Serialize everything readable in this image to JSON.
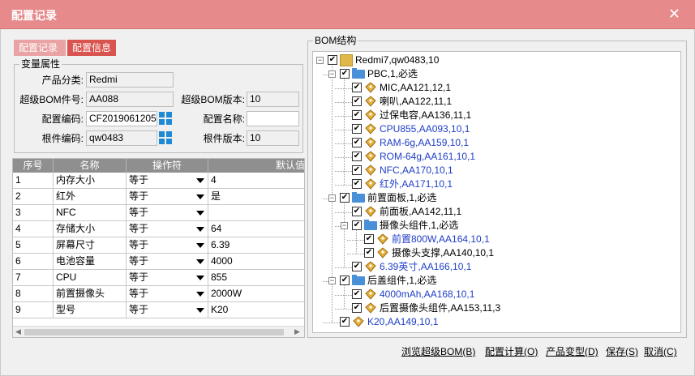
{
  "window": {
    "title": "配置记录"
  },
  "tabs": [
    {
      "label": "配置记录"
    },
    {
      "label": "配置信息"
    }
  ],
  "variables": {
    "legend": "变量属性",
    "product_category_label": "产品分类:",
    "product_category_value": "Redmi",
    "super_bom_no_label": "超级BOM件号:",
    "super_bom_no_value": "AA088",
    "super_bom_ver_label": "超级BOM版本:",
    "super_bom_ver_value": "10",
    "config_code_label": "配置编码:",
    "config_code_value": "CF2019061205",
    "config_name_label": "配置名称:",
    "config_name_value": "",
    "root_code_label": "根件编码:",
    "root_code_value": "qw0483",
    "root_ver_label": "根件版本:",
    "root_ver_value": "10"
  },
  "grid": {
    "headers": [
      "序号",
      "名称",
      "操作符",
      "默认值"
    ],
    "rows": [
      {
        "no": "1",
        "name": "内存大小",
        "op": "等于",
        "val": "4"
      },
      {
        "no": "2",
        "name": "红外",
        "op": "等于",
        "val": "是"
      },
      {
        "no": "3",
        "name": "NFC",
        "op": "等于",
        "val": ""
      },
      {
        "no": "4",
        "name": "存储大小",
        "op": "等于",
        "val": "64"
      },
      {
        "no": "5",
        "name": "屏幕尺寸",
        "op": "等于",
        "val": "6.39"
      },
      {
        "no": "6",
        "name": "电池容量",
        "op": "等于",
        "val": "4000"
      },
      {
        "no": "7",
        "name": "CPU",
        "op": "等于",
        "val": "855"
      },
      {
        "no": "8",
        "name": "前置摄像头",
        "op": "等于",
        "val": "2000W"
      },
      {
        "no": "9",
        "name": "型号",
        "op": "等于",
        "val": "K20"
      }
    ]
  },
  "bom": {
    "legend": "BOM结构",
    "nodes": [
      {
        "label": "Redmi7,qw0483,10",
        "icon": "box-icon",
        "blue": false
      },
      {
        "label": "PBC,1,必选",
        "icon": "folder-icon",
        "blue": false
      },
      {
        "label": "MIC,AA121,12,1",
        "icon": "part-icon",
        "blue": false
      },
      {
        "label": "喇叭,AA122,11,1",
        "icon": "part-icon",
        "blue": false
      },
      {
        "label": "过保电容,AA136,11,1",
        "icon": "part-icon",
        "blue": false
      },
      {
        "label": "CPU855,AA093,10,1",
        "icon": "part-icon",
        "blue": true
      },
      {
        "label": "RAM-6g,AA159,10,1",
        "icon": "part-icon",
        "blue": true
      },
      {
        "label": "ROM-64g,AA161,10,1",
        "icon": "part-icon",
        "blue": true
      },
      {
        "label": "NFC,AA170,10,1",
        "icon": "part-icon",
        "blue": true
      },
      {
        "label": "红外,AA171,10,1",
        "icon": "part-icon",
        "blue": true
      },
      {
        "label": "前置面板,1,必选",
        "icon": "folder-icon",
        "blue": false
      },
      {
        "label": "前面板,AA142,11,1",
        "icon": "part-icon",
        "blue": false
      },
      {
        "label": "摄像头组件,1,必选",
        "icon": "folder-icon",
        "blue": false
      },
      {
        "label": "前置800W,AA164,10,1",
        "icon": "part-icon",
        "blue": true
      },
      {
        "label": "摄像头支撑,AA140,10,1",
        "icon": "part-icon",
        "blue": false
      },
      {
        "label": "6.39英寸,AA166,10,1",
        "icon": "part-icon",
        "blue": true
      },
      {
        "label": "后盖组件,1,必选",
        "icon": "folder-icon",
        "blue": false
      },
      {
        "label": "4000mAh,AA168,10,1",
        "icon": "part-icon",
        "blue": true
      },
      {
        "label": "后置摄像头组件,AA153,11,3",
        "icon": "part-icon",
        "blue": false
      },
      {
        "label": "K20,AA149,10,1",
        "icon": "part-icon",
        "blue": true
      }
    ]
  },
  "buttons": {
    "browse": "浏览超级BOM(B)",
    "calc": "配置计算(O)",
    "variant": "产品变型(D)",
    "save": "保存(S)",
    "cancel": "取消(C)"
  },
  "colors": {
    "titlebar": "#e68a8c",
    "tab_active": "#d9534f",
    "tab_inactive": "#e9a3a4",
    "link_blue": "#1f3ec7",
    "qr_blue": "#1e8ad6"
  }
}
